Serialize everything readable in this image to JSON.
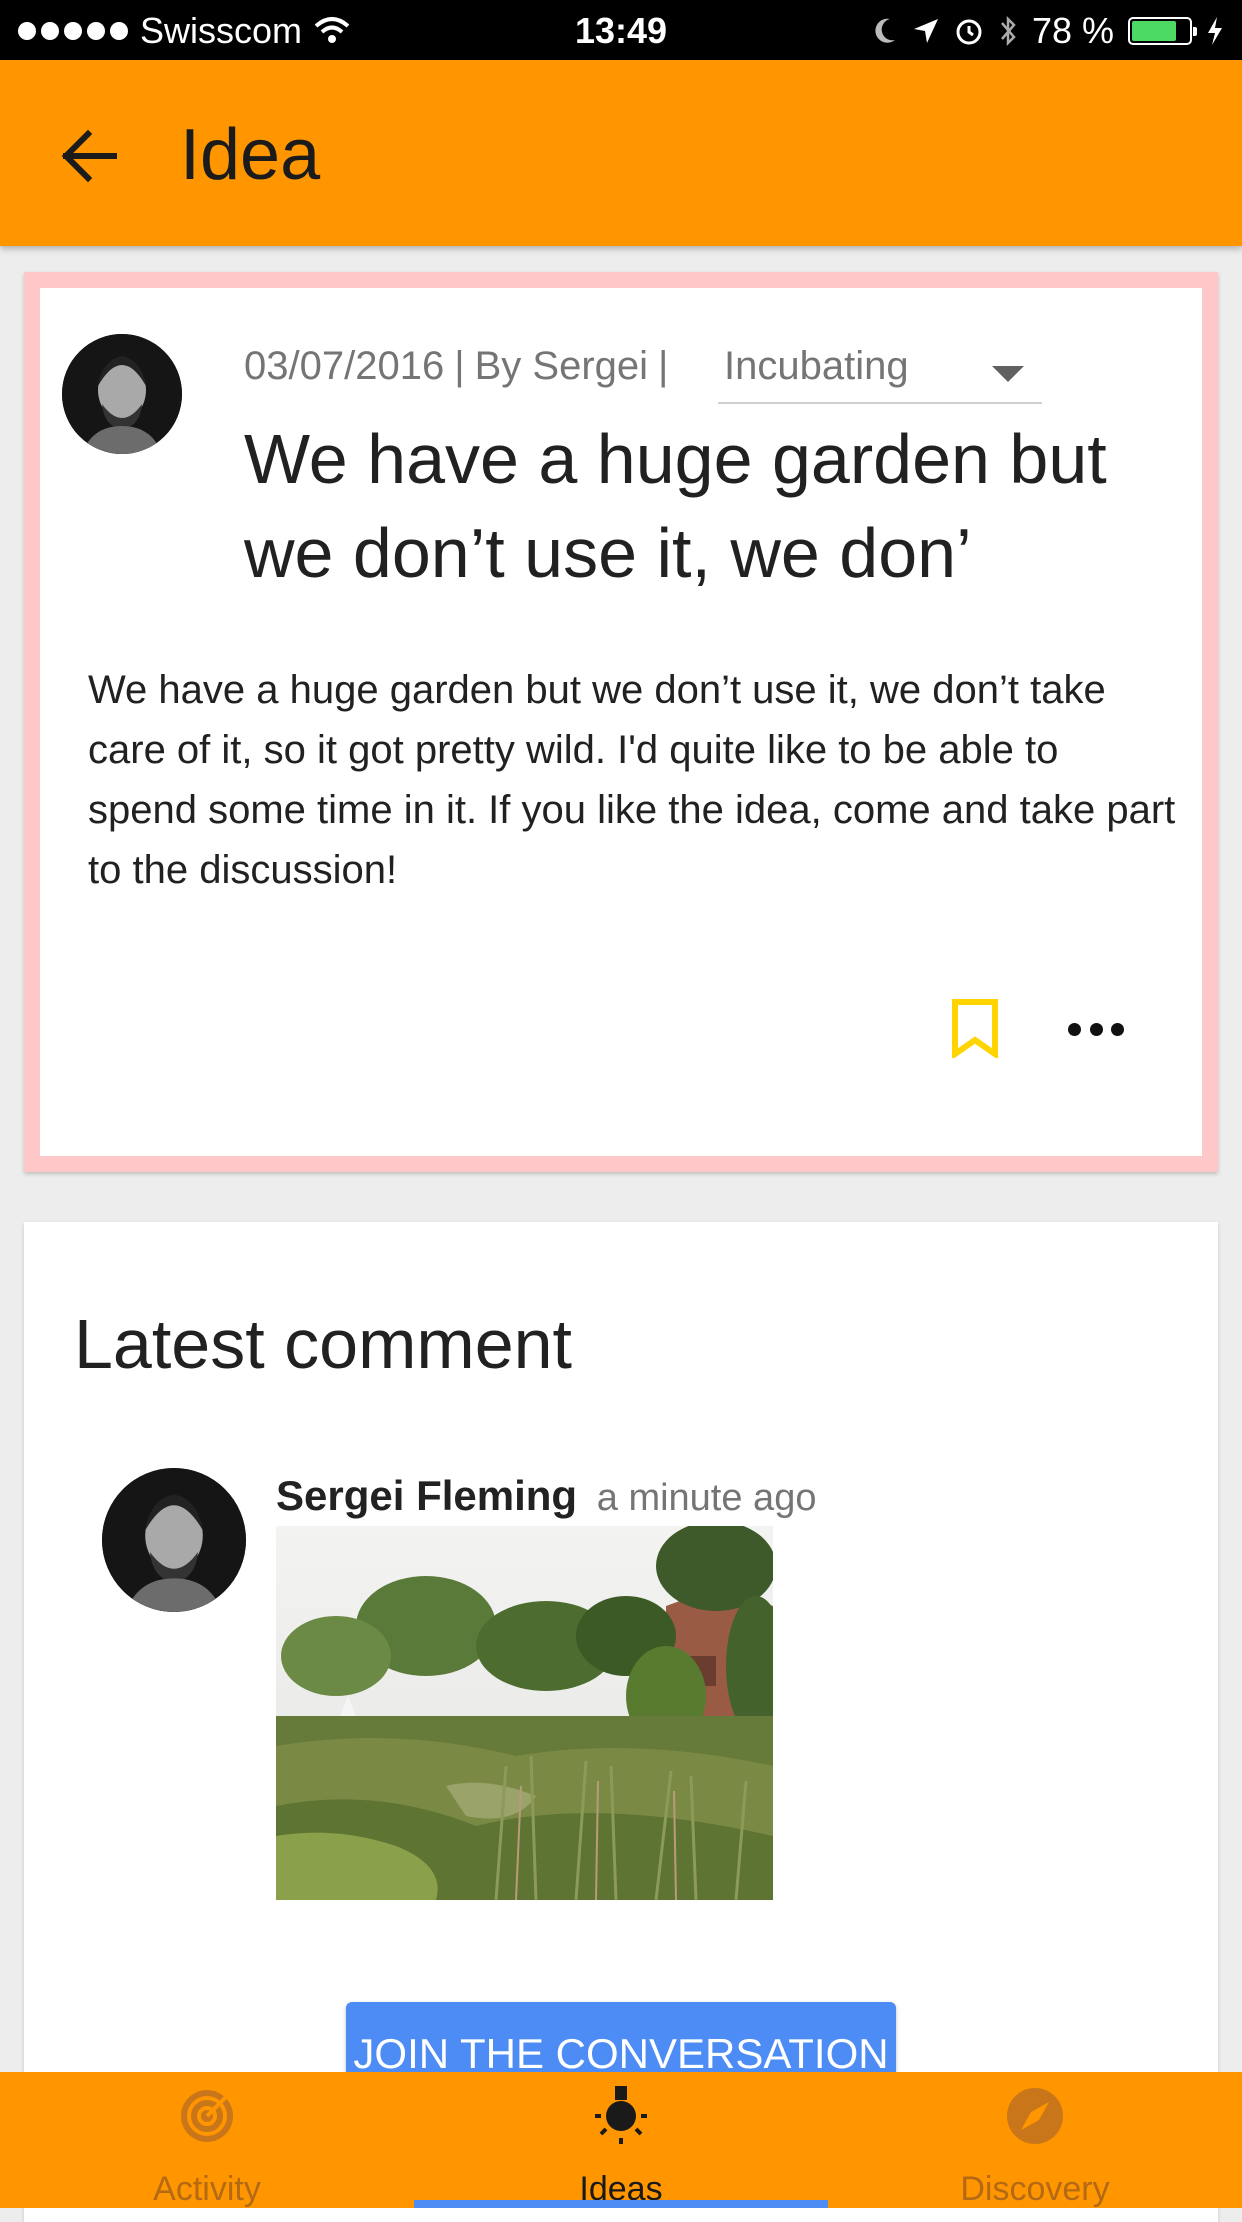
{
  "status_bar": {
    "carrier": "Swisscom",
    "time": "13:49",
    "battery_text": "78 %",
    "battery_level": 0.78
  },
  "app_bar": {
    "title": "Idea",
    "back_icon": "arrow-left-icon"
  },
  "idea": {
    "date": "03/07/2016",
    "separator": "|",
    "author_prefix": "By Sergei",
    "status": "Incubating",
    "title": "We have a huge garden but we don’t use it, we don’",
    "body": "We have a huge garden but we don’t use it, we don’t take care of it, so it got pretty wild. I'd quite like to be able to spend some time in it. If you like the idea, come and take part to the discussion!",
    "bookmark_color": "#ffd400"
  },
  "comment_section": {
    "heading": "Latest comment",
    "author": "Sergei Fleming",
    "time_ago": "a minute ago"
  },
  "join_button": {
    "label": "JOIN THE CONVERSATION"
  },
  "bottom_nav": {
    "items": [
      {
        "label": "Activity",
        "icon": "activity-radar-icon"
      },
      {
        "label": "Ideas",
        "icon": "lightbulb-icon"
      },
      {
        "label": "Discovery",
        "icon": "compass-icon"
      }
    ],
    "active_index": 1
  },
  "colors": {
    "accent": "#ff9600",
    "highlight_border": "#ffc8c8",
    "button_blue": "#4d8cf5"
  }
}
